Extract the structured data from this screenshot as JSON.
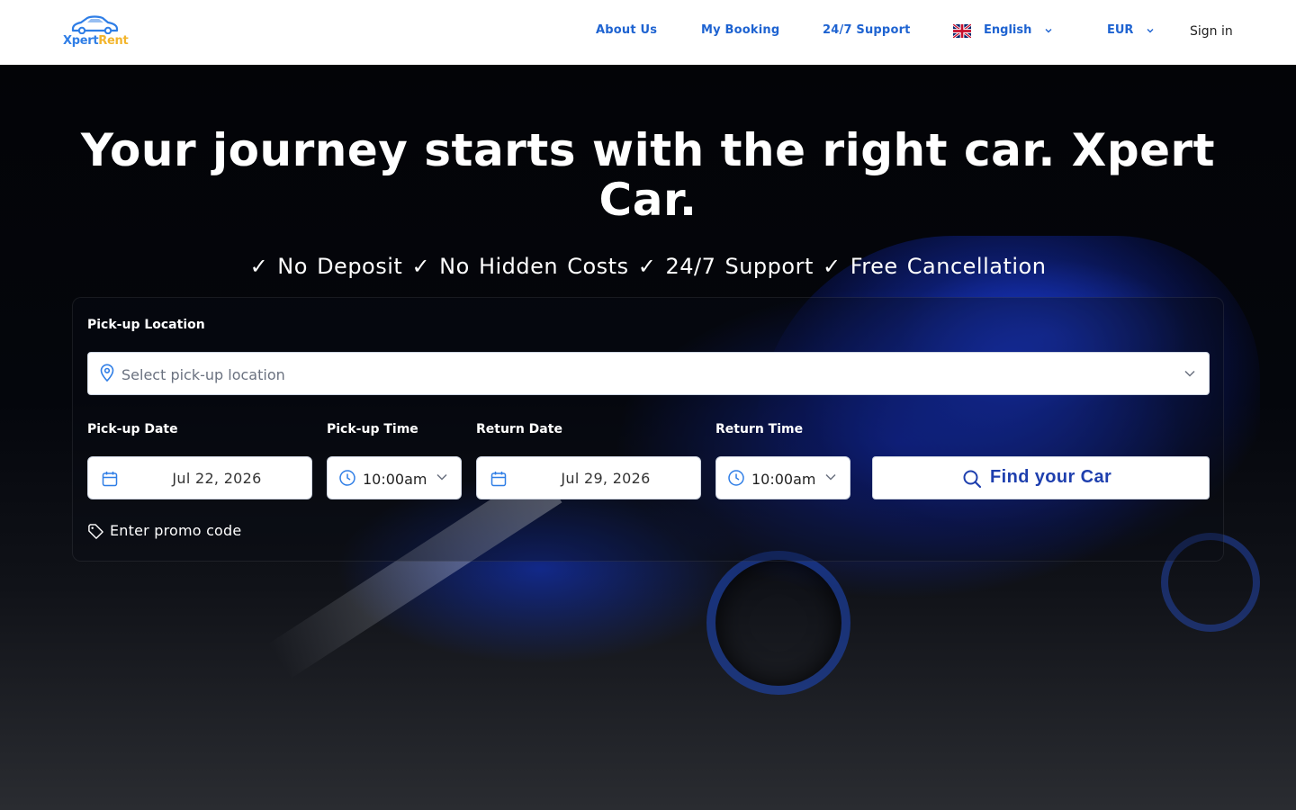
{
  "brand": {
    "name_part1": "Xpert",
    "name_part2": "Rent",
    "primary_color": "#2f7ee6",
    "accent_color": "#f3b52c"
  },
  "nav": {
    "about": "About Us",
    "booking": "My Booking",
    "support": "24/7 Support",
    "language": {
      "label": "English",
      "flag_icon": "uk-flag-icon"
    },
    "currency": "EUR",
    "signin": "Sign in"
  },
  "hero": {
    "title": "Your journey starts with the right car. Xpert Car.",
    "subtitle": "✓ No Deposit ✓ No Hidden Costs ✓ 24/7 Support ✓ Free Cancellation"
  },
  "search": {
    "pickup_location": {
      "label": "Pick-up Location",
      "placeholder": "Select pick-up location",
      "value": ""
    },
    "pickup_date": {
      "label": "Pick-up Date",
      "value": "Jul 22, 2026"
    },
    "pickup_time": {
      "label": "Pick-up Time",
      "value": "10:00am"
    },
    "return_date": {
      "label": "Return Date",
      "value": "Jul 29, 2026"
    },
    "return_time": {
      "label": "Return Time",
      "value": "10:00am"
    },
    "submit": "Find your Car",
    "promo": "Enter promo code"
  }
}
